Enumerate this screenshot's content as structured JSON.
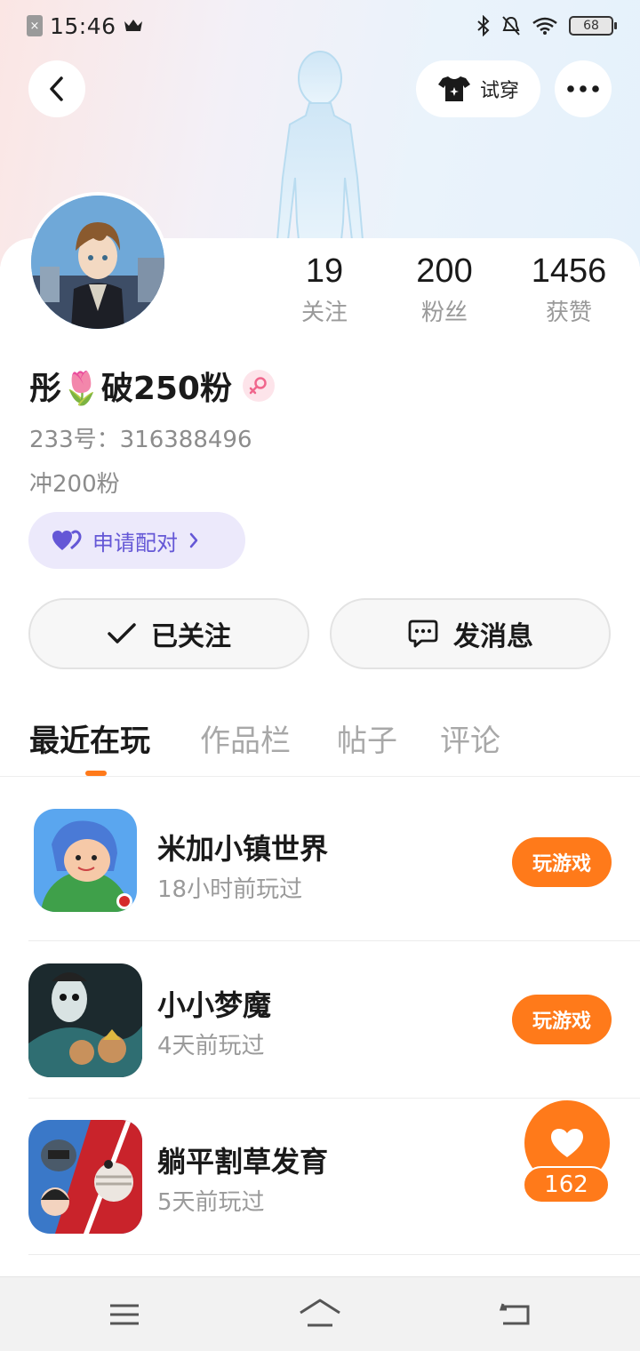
{
  "status_bar": {
    "time": "15:46",
    "battery": "68"
  },
  "header": {
    "try_on_label": "试穿"
  },
  "profile": {
    "stats": [
      {
        "value": "19",
        "label": "关注"
      },
      {
        "value": "200",
        "label": "粉丝"
      },
      {
        "value": "1456",
        "label": "获赞"
      }
    ],
    "name": "彤🌷破250粉",
    "uid": "233号：316388496",
    "bio": "冲200粉",
    "pair_label": "申请配对"
  },
  "actions": {
    "follow_label": "已关注",
    "message_label": "发消息"
  },
  "tabs": [
    {
      "label": "最近在玩",
      "active": true
    },
    {
      "label": "作品栏",
      "active": false
    },
    {
      "label": "帖子",
      "active": false
    },
    {
      "label": "评论",
      "active": false
    }
  ],
  "games": [
    {
      "title": "米加小镇世界",
      "subtitle": "18小时前玩过",
      "button": "玩游戏"
    },
    {
      "title": "小小梦魔",
      "subtitle": "4天前玩过",
      "button": "玩游戏"
    },
    {
      "title": "躺平割草发育",
      "subtitle": "5天前玩过"
    }
  ],
  "like_float": {
    "count": "162"
  },
  "colors": {
    "accent": "#ff7a1a",
    "pair": "#6457d6",
    "pair_bg": "#ece9fb"
  }
}
